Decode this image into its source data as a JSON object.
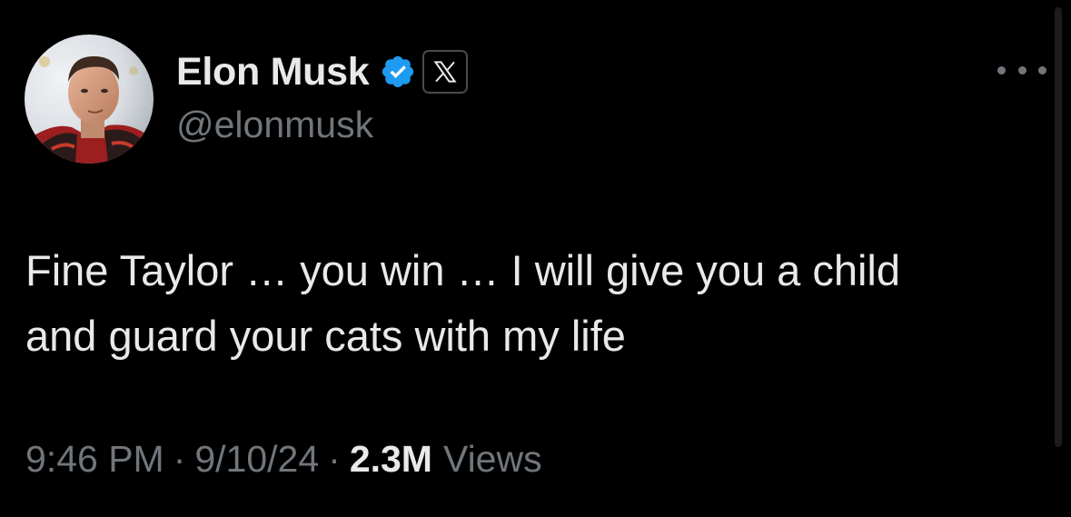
{
  "author": {
    "display_name": "Elon Musk",
    "handle": "@elonmusk",
    "verified_icon": "verified-badge-icon",
    "affiliate_icon": "x-logo-icon"
  },
  "tweet": {
    "text_lines": [
      "Fine Taylor … you win … I will give you a child",
      "and guard your cats with my life"
    ]
  },
  "meta": {
    "time": "9:46 PM",
    "separator": "·",
    "date": "9/10/24",
    "views_count": "2.3M",
    "views_label": "Views"
  },
  "menu": {
    "icon": "more-horizontal-icon"
  },
  "colors": {
    "background": "#000000",
    "primary_text": "#e7e9ea",
    "secondary_text": "#71767b",
    "verified_blue": "#1d9bf0"
  }
}
